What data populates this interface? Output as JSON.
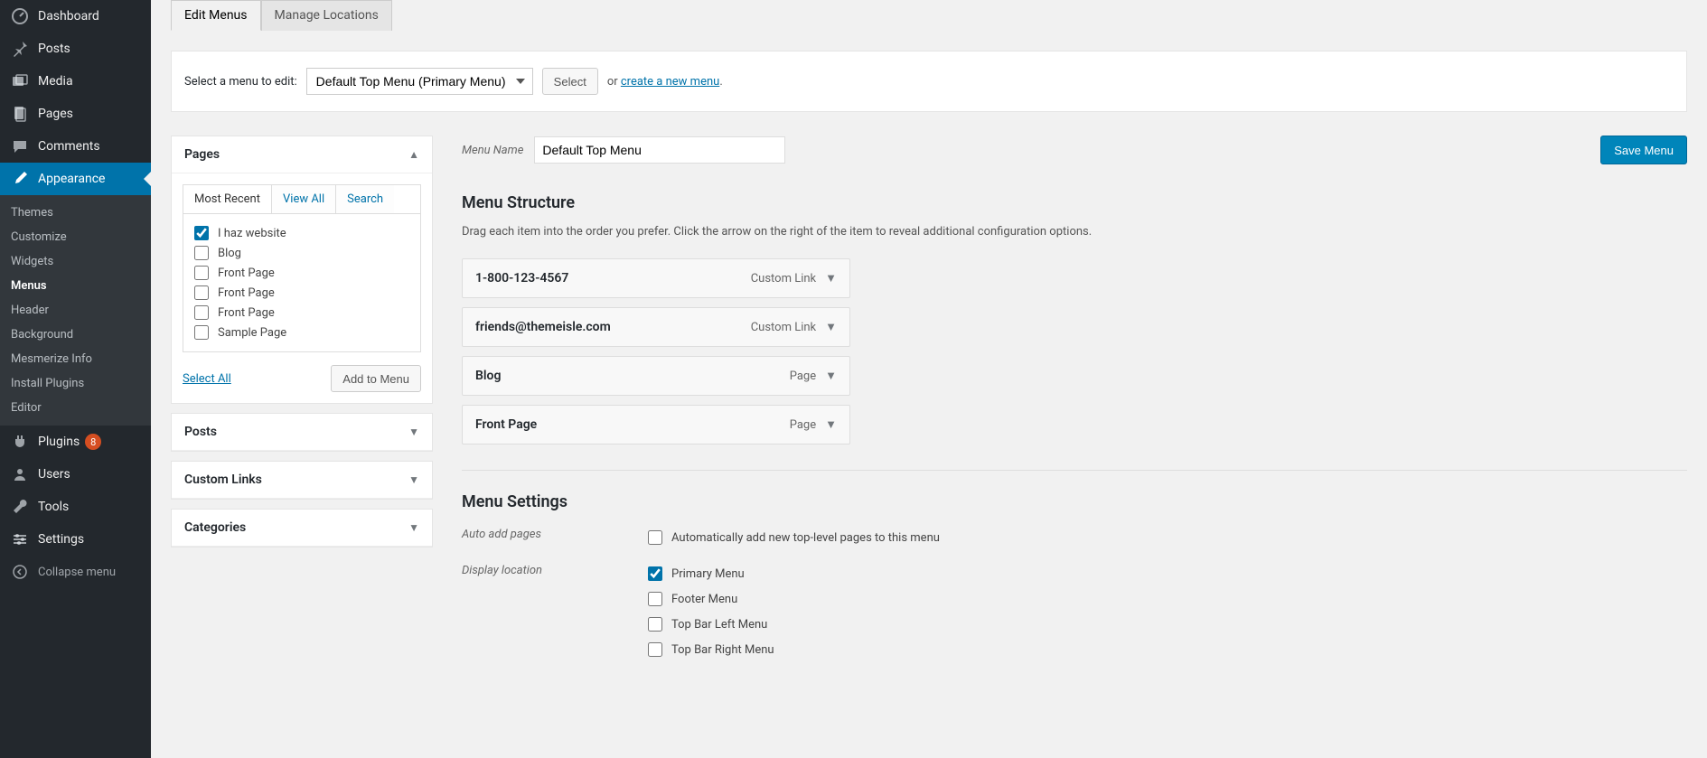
{
  "sidebar": {
    "items": [
      {
        "label": "Dashboard",
        "icon": "dashboard"
      },
      {
        "label": "Posts",
        "icon": "pin"
      },
      {
        "label": "Media",
        "icon": "media"
      },
      {
        "label": "Pages",
        "icon": "pages"
      },
      {
        "label": "Comments",
        "icon": "comment"
      },
      {
        "label": "Appearance",
        "icon": "brush",
        "active": true
      },
      {
        "label": "Plugins",
        "icon": "plug",
        "badge": "8"
      },
      {
        "label": "Users",
        "icon": "user"
      },
      {
        "label": "Tools",
        "icon": "wrench"
      },
      {
        "label": "Settings",
        "icon": "settings"
      }
    ],
    "submenu": [
      "Themes",
      "Customize",
      "Widgets",
      "Menus",
      "Header",
      "Background",
      "Mesmerize Info",
      "Install Plugins",
      "Editor"
    ],
    "submenu_current": "Menus",
    "collapse": "Collapse menu"
  },
  "tabs": {
    "edit": "Edit Menus",
    "manage": "Manage Locations"
  },
  "select_row": {
    "label": "Select a menu to edit:",
    "selected": "Default Top Menu (Primary Menu)",
    "select_btn": "Select",
    "or": "or",
    "create_link": "create a new menu",
    "period": "."
  },
  "metaboxes": {
    "pages": {
      "title": "Pages",
      "subtabs": {
        "recent": "Most Recent",
        "all": "View All",
        "search": "Search"
      },
      "items": [
        {
          "label": "I haz website",
          "checked": true
        },
        {
          "label": "Blog",
          "checked": false
        },
        {
          "label": "Front Page",
          "checked": false
        },
        {
          "label": "Front Page",
          "checked": false
        },
        {
          "label": "Front Page",
          "checked": false
        },
        {
          "label": "Sample Page",
          "checked": false
        }
      ],
      "select_all": "Select All",
      "add_btn": "Add to Menu"
    },
    "posts": "Posts",
    "custom_links": "Custom Links",
    "categories": "Categories"
  },
  "menu": {
    "name_label": "Menu Name",
    "name_value": "Default Top Menu",
    "save_btn": "Save Menu",
    "structure_title": "Menu Structure",
    "structure_help": "Drag each item into the order you prefer. Click the arrow on the right of the item to reveal additional configuration options.",
    "items": [
      {
        "title": "1-800-123-4567",
        "type": "Custom Link"
      },
      {
        "title": "friends@themeisle.com",
        "type": "Custom Link"
      },
      {
        "title": "Blog",
        "type": "Page"
      },
      {
        "title": "Front Page",
        "type": "Page"
      }
    ]
  },
  "settings": {
    "title": "Menu Settings",
    "auto_add_label": "Auto add pages",
    "auto_add_option": "Automatically add new top-level pages to this menu",
    "display_label": "Display location",
    "locations": [
      {
        "label": "Primary Menu",
        "checked": true
      },
      {
        "label": "Footer Menu",
        "checked": false
      },
      {
        "label": "Top Bar Left Menu",
        "checked": false
      },
      {
        "label": "Top Bar Right Menu",
        "checked": false
      }
    ]
  }
}
